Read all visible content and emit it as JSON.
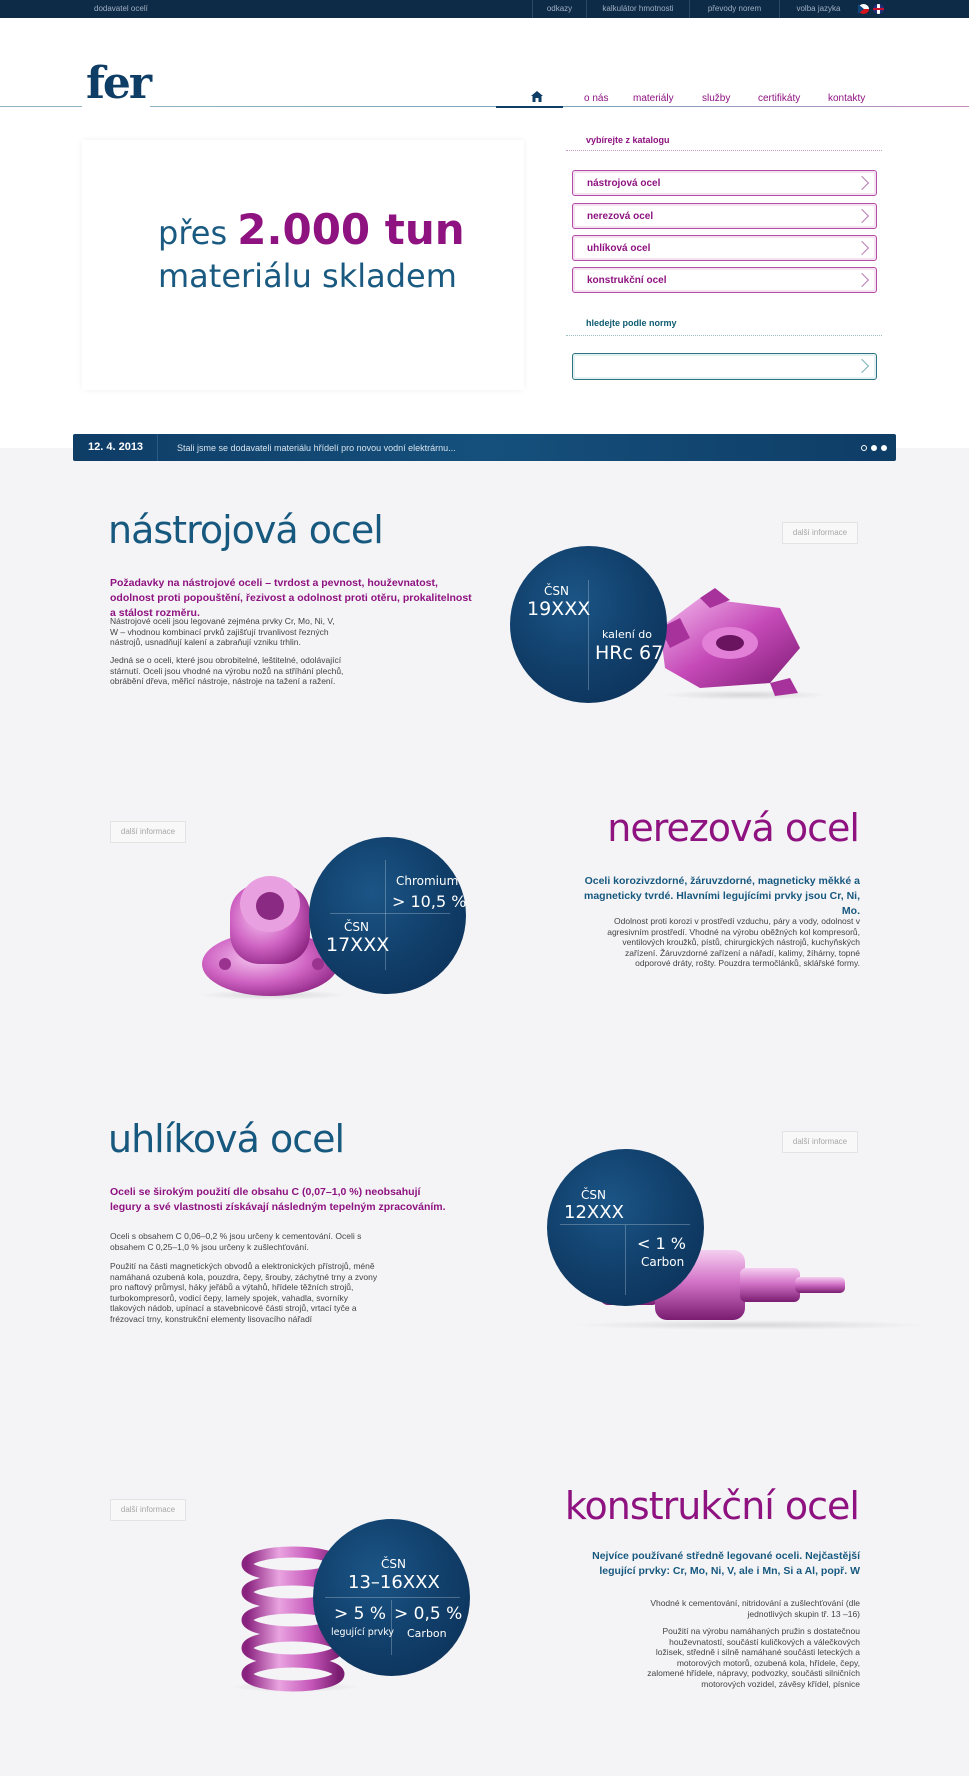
{
  "topbar": {
    "tagline": "dodavatel ocelí",
    "links": [
      "odkazy",
      "kalkulátor hmotnosti",
      "převody norem",
      "volba jazyka"
    ]
  },
  "header": {
    "logo": "fer",
    "nav": [
      "o nás",
      "materiály",
      "služby",
      "certifikáty",
      "kontakty"
    ]
  },
  "hero": {
    "prefix": "přes",
    "highlight": "2.000 tun",
    "line2": "materiálu skladem"
  },
  "catalog": {
    "heading": "vybírejte z katalogu",
    "items": [
      "nástrojová ocel",
      "nerezová ocel",
      "uhlíková ocel",
      "konstrukční ocel"
    ],
    "norm_heading": "hledejte podle normy",
    "norm_value": ""
  },
  "news": {
    "date": "12. 4. 2013",
    "text": "Stali jsme se dodavateli materiálu hřídelí pro novou vodní elektrárnu...",
    "dots": 3
  },
  "more_label": "další informace",
  "sections": {
    "tool": {
      "title": "nástrojová ocel",
      "lead": "Požadavky na nástrojové oceli – tvrdost a pevnost, houževnatost, odolnost proti popouštění, řezivost a odolnost proti otěru, prokalitelnost a stálost rozměru.",
      "p1": "Nástrojové oceli jsou legované zejména prvky Cr, Mo, Ni, V, W – vhodnou kombinací prvků zajišťují trvanlivost řezných nástrojů, usnadňují kalení a zabraňují vzniku trhlin.",
      "p2": "Jedná se o oceli, které jsou obrobitelné, leštitelné, odolávající stárnutí. Oceli jsou vhodné na výrobu nožů na stříhání plechů, obrábění dřeva, měřicí nástroje, nástroje na tažení a ražení.",
      "csn_label": "ČSN",
      "csn": "19XXX",
      "stat_label": "kalení do",
      "stat": "HRc 67"
    },
    "stainless": {
      "title": "nerezová ocel",
      "lead": "Oceli korozivzdorné, žáruvzdorné, magneticky měkké a magneticky tvrdé. Hlavními legujícími prvky jsou Cr, Ni, Mo.",
      "p1": "Odolnost proti korozi v prostředí vzduchu, páry a vody, odolnost v agresivním prostředí. Vhodné na výrobu oběžných kol kompresorů, ventilových kroužků, pístů, chirurgických nástrojů, kuchyňských zařízení. Žáruvzdorné zařízení a nářadí, kalimy, žíhárny, topné odporové dráty, rošty. Pouzdra termočlánků, sklářské formy.",
      "stat_label": "Chromium",
      "stat": "> 10,5 %",
      "csn_label": "ČSN",
      "csn": "17XXX"
    },
    "carbon": {
      "title": "uhlíková ocel",
      "lead": "Oceli se širokým použití dle obsahu C (0,07–1,0 %) neobsahují legury a své vlastnosti získávají následným tepelným zpracováním.",
      "p1": "Oceli s obsahem C 0,06–0,2 % jsou určeny k cementování. Oceli s obsahem C 0,25–1,0 % jsou určeny k zušlechťování.",
      "p2": "Použití na části magnetických obvodů a elektronických přístrojů, méně namáhaná ozubená kola, pouzdra, čepy, šrouby, záchytné trny a zvony pro naftový průmysl, háky jeřábů a výtahů, hřídele těžních strojů, turbokompresorů, vodicí čepy, lamely spojek, vahadla, svorníky tlakových nádob, upínací a stavebnicové části strojů, vrtací tyče a frézovací trny, konstrukční elementy lisovacího nářadí",
      "csn_label": "ČSN",
      "csn": "12XXX",
      "stat": "< 1 %",
      "stat_label": "Carbon"
    },
    "structural": {
      "title": "konstrukční ocel",
      "lead": "Nejvíce používané středně legované oceli. Nejčastější legující prvky: Cr, Mo, Ni, V, ale i Mn, Si a Al, popř. W",
      "p1": "Vhodné k cementování, nitridování a zušlechťování (dle jednotlivých skupin tř. 13 –16)",
      "p2": "Použití na výrobu namáhaných pružin s dostatečnou houževnatostí, součástí kuličkových a válečkových ložisek, středně i silně namáhané součásti leteckých a motorových motorů, ozubená kola, hřídele, čepy, zalomené hřídele, nápravy, podvozky, součásti silničních motorových vozidel, závěsy křídel, písnice",
      "csn_label": "ČSN",
      "csn": "13–16XXX",
      "stat1": "> 5 %",
      "stat1_label": "legující prvky",
      "stat2": "> 0,5 %",
      "stat2_label": "Carbon"
    }
  },
  "colors": {
    "navy": "#0e3d66",
    "magenta": "#8e1280",
    "teal": "#17587f"
  }
}
